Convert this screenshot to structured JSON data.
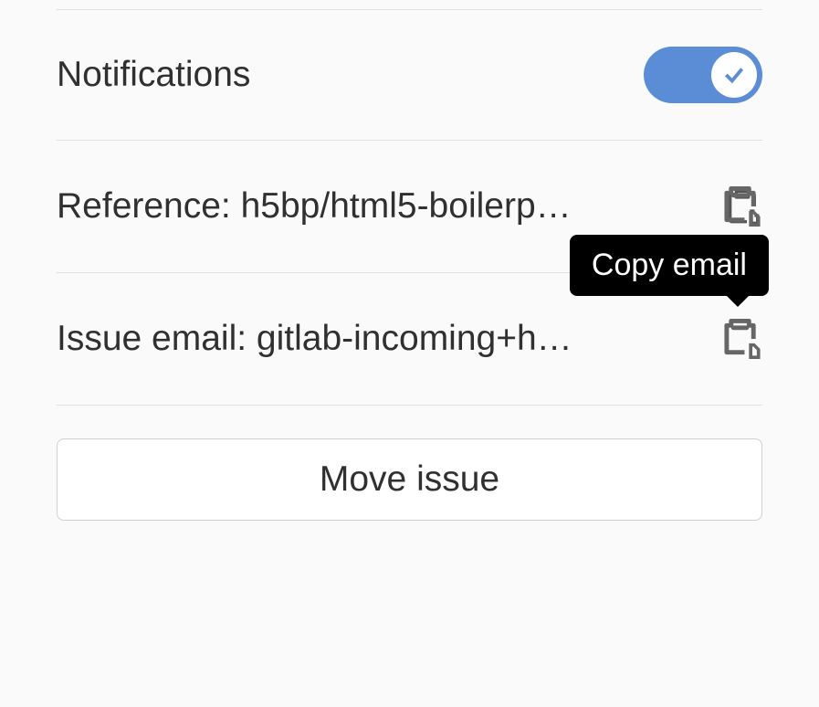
{
  "notifications": {
    "label": "Notifications",
    "enabled": true
  },
  "reference": {
    "prefix": "Reference: ",
    "value": "h5bp/html5-boilerp…"
  },
  "issue_email": {
    "prefix": "Issue email: ",
    "value": "gitlab-incoming+h…",
    "tooltip": "Copy email"
  },
  "move_issue": {
    "label": "Move issue"
  }
}
